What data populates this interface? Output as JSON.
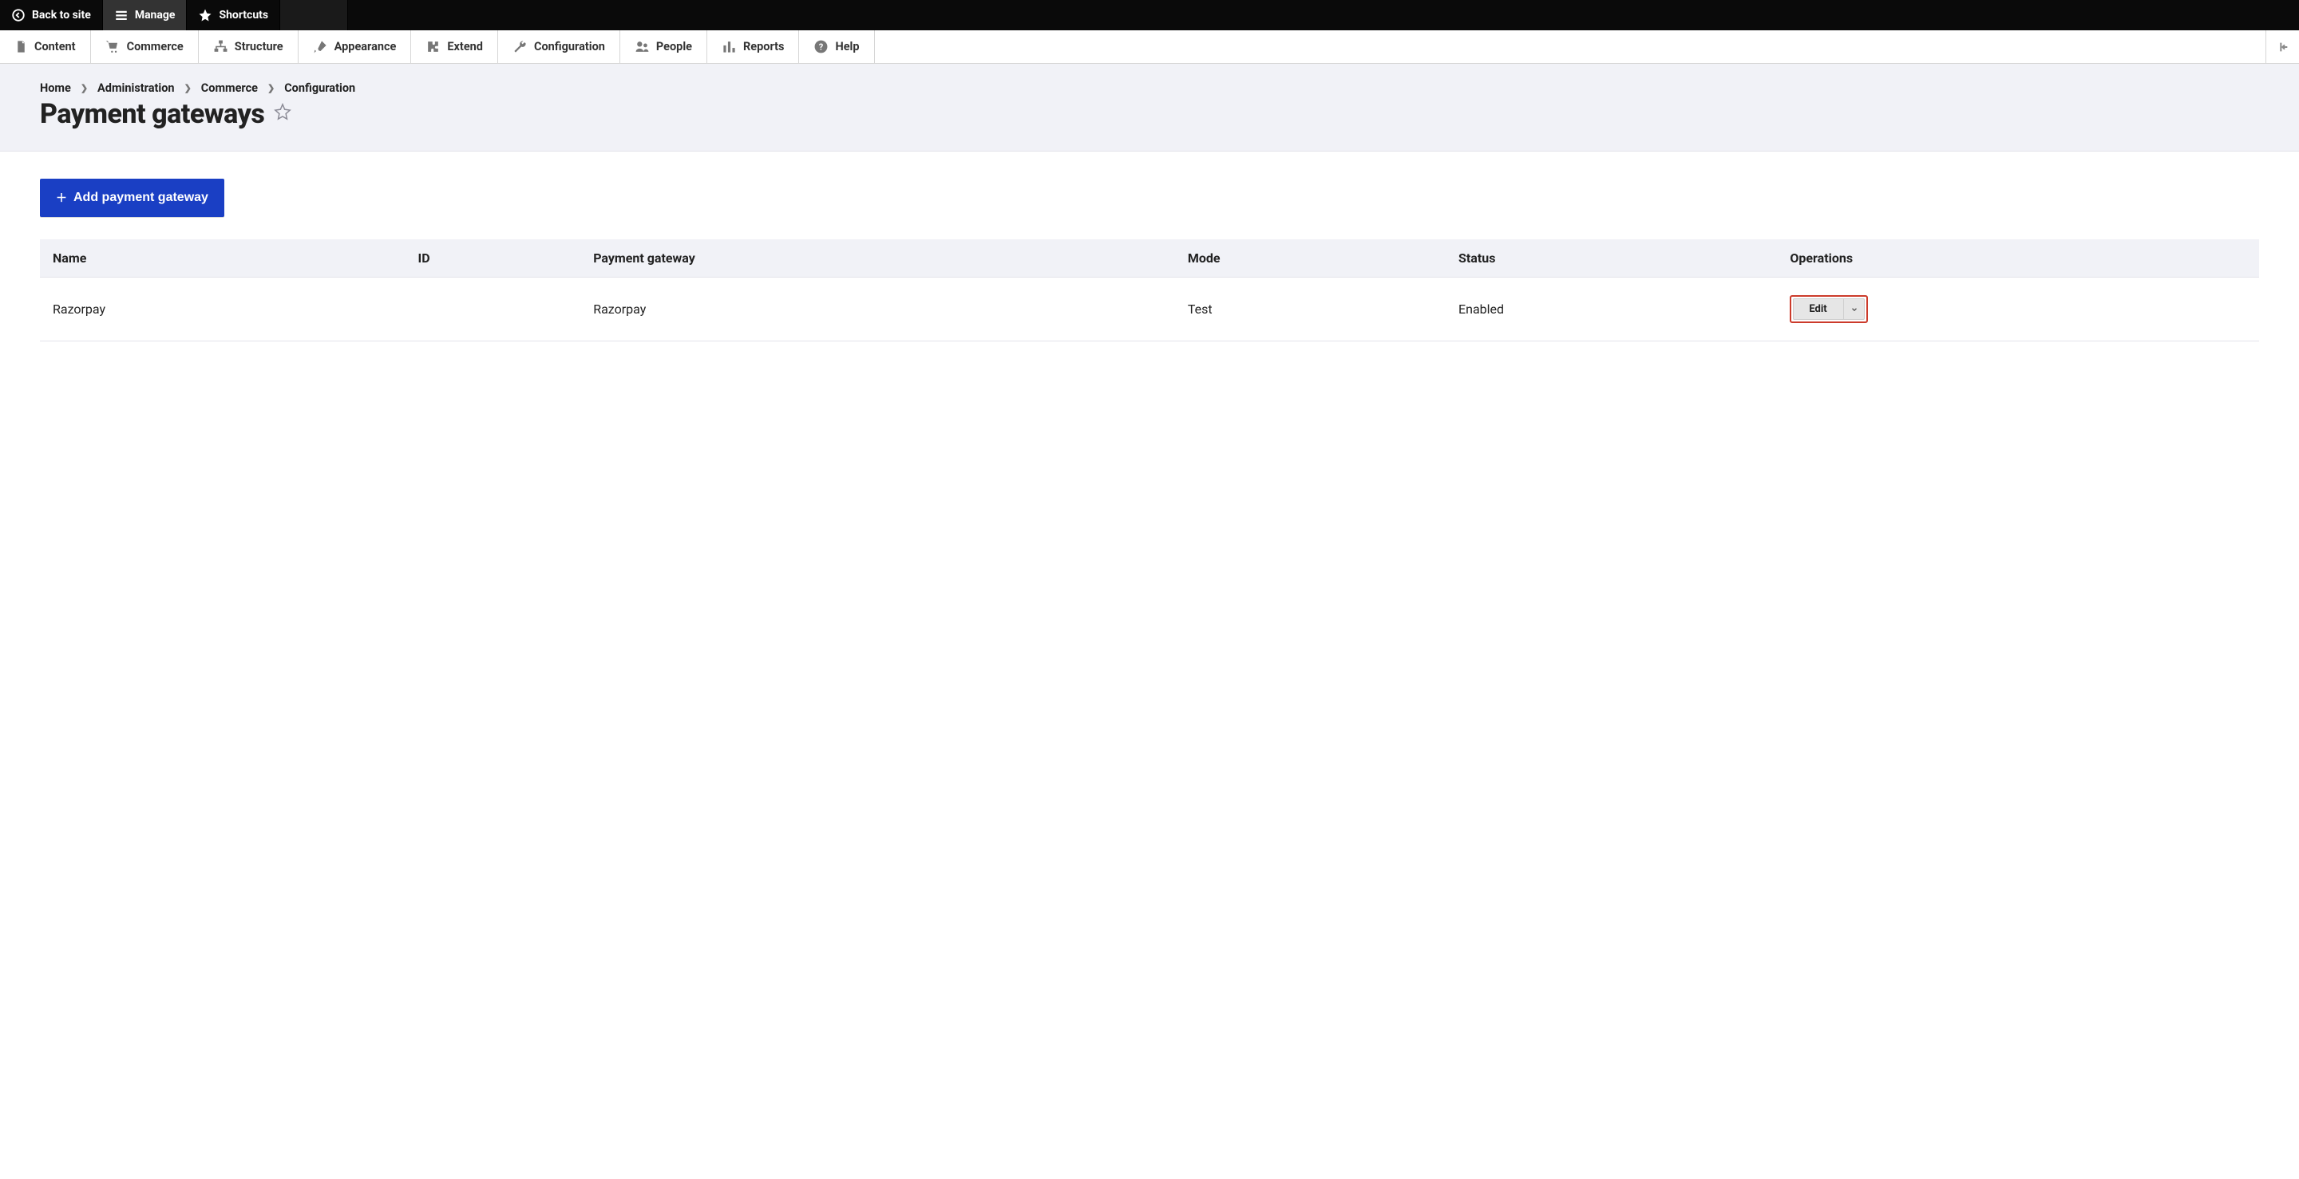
{
  "topbar": {
    "back": "Back to site",
    "manage": "Manage",
    "shortcuts": "Shortcuts"
  },
  "adminnav": {
    "content": "Content",
    "commerce": "Commerce",
    "structure": "Structure",
    "appearance": "Appearance",
    "extend": "Extend",
    "configuration": "Configuration",
    "people": "People",
    "reports": "Reports",
    "help": "Help"
  },
  "breadcrumb": [
    "Home",
    "Administration",
    "Commerce",
    "Configuration"
  ],
  "page_title": "Payment gateways",
  "buttons": {
    "add_gateway": "Add payment gateway"
  },
  "table": {
    "headers": {
      "name": "Name",
      "id": "ID",
      "gateway": "Payment gateway",
      "mode": "Mode",
      "status": "Status",
      "operations": "Operations"
    },
    "rows": [
      {
        "name": "Razorpay",
        "id": "",
        "gateway": "Razorpay",
        "mode": "Test",
        "status": "Enabled",
        "action": "Edit"
      }
    ]
  }
}
